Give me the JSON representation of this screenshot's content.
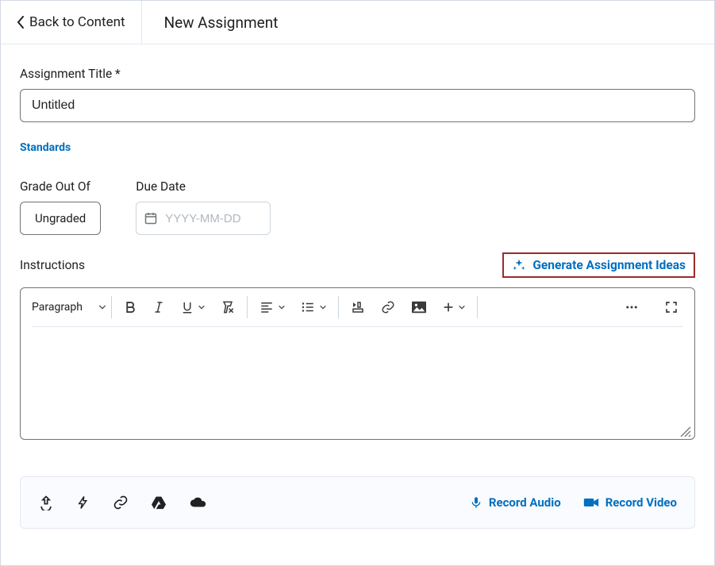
{
  "header": {
    "back_label": "Back to Content",
    "page_title": "New Assignment"
  },
  "form": {
    "title_label": "Assignment Title *",
    "title_value": "Untitled",
    "standards_link": "Standards",
    "grade": {
      "label": "Grade Out Of",
      "value": "Ungraded"
    },
    "due_date": {
      "label": "Due Date",
      "placeholder": "YYYY-MM-DD",
      "value": ""
    },
    "instructions_label": "Instructions",
    "generate_label": "Generate Assignment Ideas"
  },
  "editor": {
    "block_format": "Paragraph"
  },
  "attach": {
    "record_audio": "Record Audio",
    "record_video": "Record Video"
  }
}
